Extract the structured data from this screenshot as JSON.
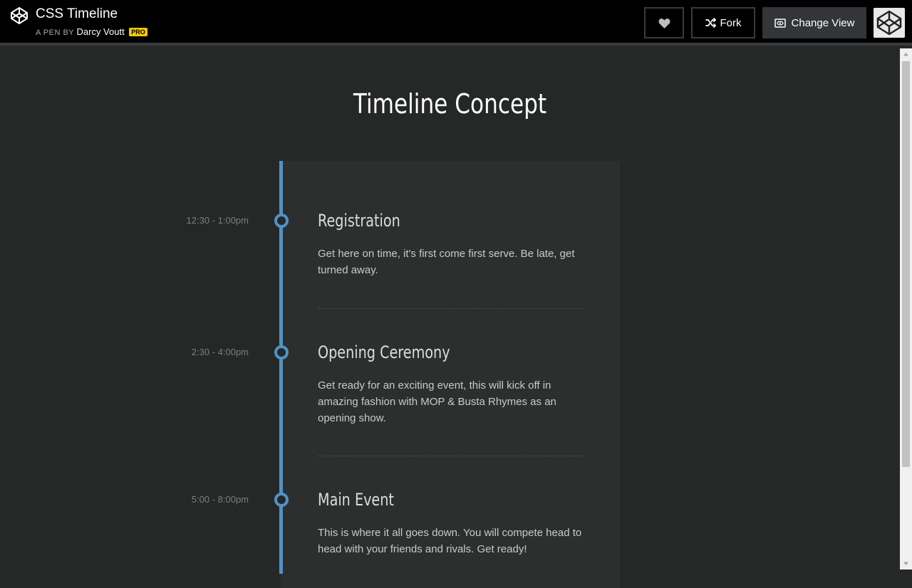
{
  "header": {
    "pen_title": "CSS Timeline",
    "byline_prefix": "A PEN BY",
    "author": "Darcy Voutt",
    "badge": "PRO",
    "fork_label": "Fork",
    "change_view_label": "Change View"
  },
  "page": {
    "title": "Timeline Concept"
  },
  "events": [
    {
      "time": "12:30 - 1:00pm",
      "title": "Registration",
      "description": "Get here on time, it's first come first serve. Be late, get turned away."
    },
    {
      "time": "2:30 - 4:00pm",
      "title": "Opening Ceremony",
      "description": "Get ready for an exciting event, this will kick off in amazing fashion with MOP & Busta Rhymes as an opening show."
    },
    {
      "time": "5:00 - 8:00pm",
      "title": "Main Event",
      "description": "This is where it all goes down. You will compete head to head with your friends and rivals. Get ready!"
    }
  ],
  "colors": {
    "accent": "#4f93c6",
    "background": "#252827",
    "card": "#2d2f2f",
    "pro_badge": "#f7c800"
  },
  "icons": {
    "logo": "codepen-logo-icon",
    "heart": "heart-icon",
    "fork": "fork-icon",
    "view": "change-view-icon"
  }
}
